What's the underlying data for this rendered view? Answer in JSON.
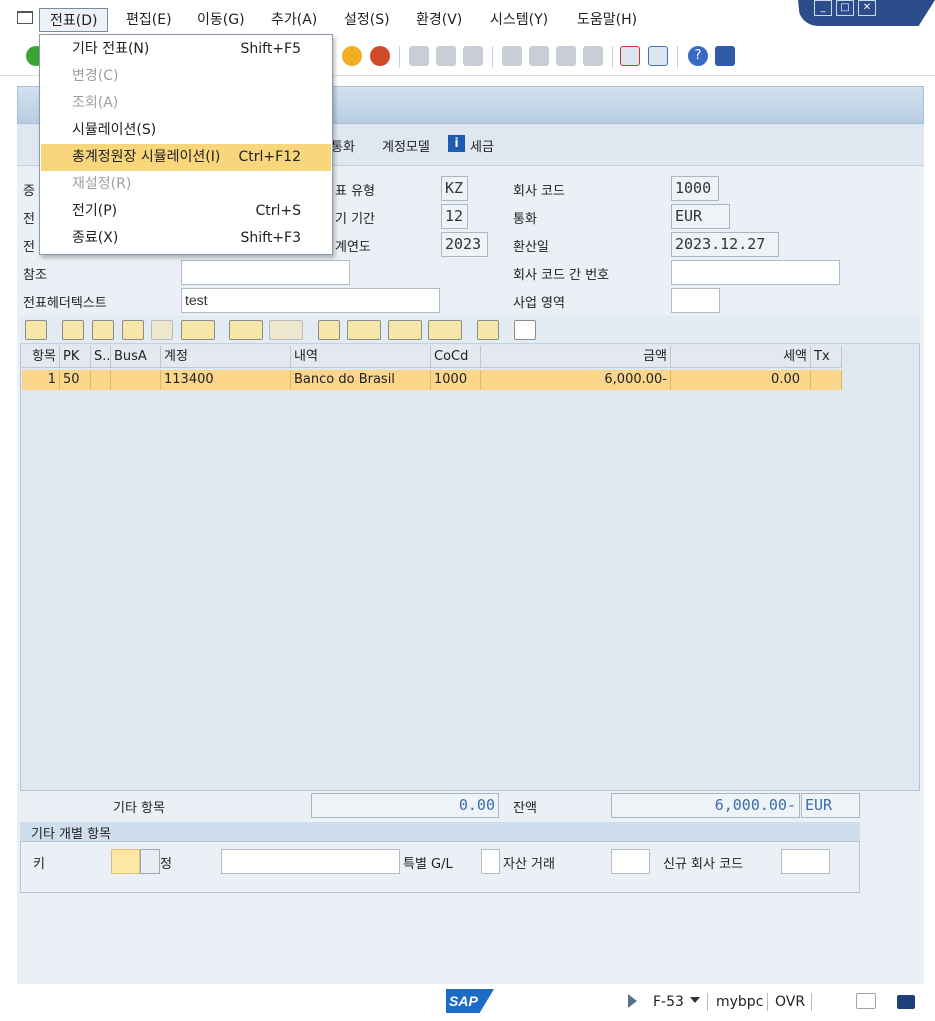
{
  "menubar": {
    "items": [
      {
        "label": "전표(D)"
      },
      {
        "label": "편집(E)"
      },
      {
        "label": "이동(G)"
      },
      {
        "label": "추가(A)"
      },
      {
        "label": "설정(S)"
      },
      {
        "label": "환경(V)"
      },
      {
        "label": "시스템(Y)"
      },
      {
        "label": "도움말(H)"
      }
    ]
  },
  "dropdown": {
    "items": [
      {
        "label": "기타 전표(N)",
        "shortcut": "Shift+F5",
        "state": "enabled"
      },
      {
        "label": "변경(C)",
        "shortcut": "",
        "state": "disabled"
      },
      {
        "label": "조회(A)",
        "shortcut": "",
        "state": "disabled"
      },
      {
        "label": "시뮬레이션(S)",
        "shortcut": "",
        "state": "enabled"
      },
      {
        "label": "총계정원장 시뮬레이션(I)",
        "shortcut": "Ctrl+F12",
        "state": "highlighted"
      },
      {
        "label": "재설정(R)",
        "shortcut": "",
        "state": "disabled"
      },
      {
        "label": "전기(P)",
        "shortcut": "Ctrl+S",
        "state": "enabled"
      },
      {
        "label": "종료(X)",
        "shortcut": "Shift+F3",
        "state": "enabled"
      }
    ]
  },
  "appbar": {
    "currency_label": "통화",
    "account_model_label": "계정모델",
    "tax_label": "세금"
  },
  "header": {
    "doc_type_label": "표 유형",
    "doc_type_value": "KZ",
    "period_label": "기 기간",
    "period_value": "12",
    "fiscal_year_label": "계연도",
    "fiscal_year_value": "2023",
    "company_code_label": "회사 코드",
    "company_code_value": "1000",
    "currency_label": "통화",
    "currency_value": "EUR",
    "exchange_date_label": "환산일",
    "exchange_date_value": "2023.12.27",
    "reference_label": "참조",
    "reference_value": "",
    "cross_cc_label": "회사 코드 간 번호",
    "cross_cc_value": "",
    "header_text_label": "전표헤더텍스트",
    "header_text_value": "test",
    "business_area_label": "사업 영역",
    "business_area_value": "",
    "left_partial_labels": [
      "증",
      "전",
      "전"
    ]
  },
  "grid": {
    "columns": [
      "항목",
      "PK",
      "S...",
      "BusA",
      "계정",
      "내역",
      "CoCd",
      "금액",
      "세액",
      "Tx"
    ],
    "rows": [
      [
        "1",
        "50",
        "",
        "",
        "113400",
        "Banco do Brasil",
        "1000",
        "6,000.00-",
        "0.00",
        ""
      ]
    ]
  },
  "totals": {
    "other_items_label": "기타 항목",
    "other_items_value": "0.00",
    "balance_label": "잔액",
    "balance_value": "6,000.00-",
    "balance_currency": "EUR"
  },
  "other_items_group": {
    "title": "기타 개별 항목",
    "key_label": "키",
    "key_value": "",
    "account_label_partial": "정",
    "account_value": "",
    "special_gl_label": "특별 G/L",
    "special_gl_value": "",
    "asset_tx_label": "자산 거래",
    "asset_tx_value": "",
    "new_cc_label": "신규 회사 코드",
    "new_cc_value": ""
  },
  "statusbar": {
    "tcode": "F-53",
    "server": "mybpc",
    "mode": "OVR",
    "logo": "SAP"
  },
  "colors": {
    "highlight": "#f8d67c",
    "row_selected": "#fbd58a",
    "window_blue": "#2d4c8c",
    "panel_bg": "#eaf0f6"
  }
}
